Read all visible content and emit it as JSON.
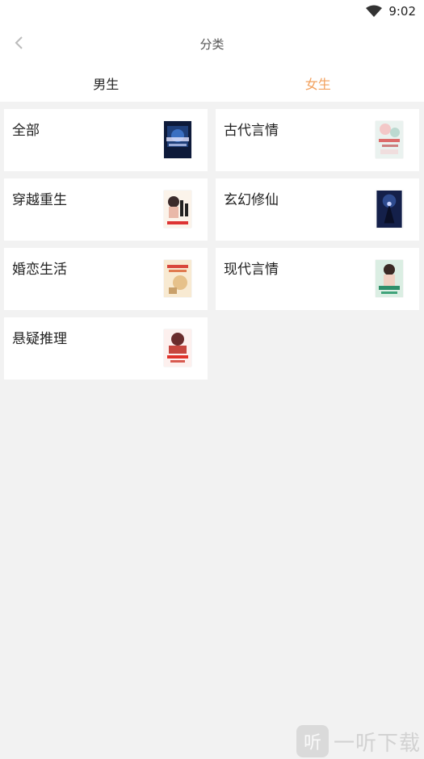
{
  "status_bar": {
    "time": "9:02"
  },
  "nav": {
    "title": "分类"
  },
  "tabs": {
    "male": "男生",
    "female": "女生",
    "active": "female"
  },
  "categories": [
    {
      "label": "全部",
      "cover": "dark-blue-fantasy-cover"
    },
    {
      "label": "古代言情",
      "cover": "pastel-ancient-romance-cover"
    },
    {
      "label": "穿越重生",
      "cover": "red-title-portrait-cover"
    },
    {
      "label": "玄幻修仙",
      "cover": "dark-swordsman-cover"
    },
    {
      "label": "婚恋生活",
      "cover": "cream-gold-romance-cover"
    },
    {
      "label": "现代言情",
      "cover": "green-modern-portrait-cover"
    },
    {
      "label": "悬疑推理",
      "cover": "red-warrior-cover"
    }
  ],
  "colors": {
    "accent": "#f2a15e",
    "background": "#f2f2f2",
    "card": "#ffffff"
  },
  "watermark": {
    "logo": "听",
    "text": "一听下载"
  }
}
